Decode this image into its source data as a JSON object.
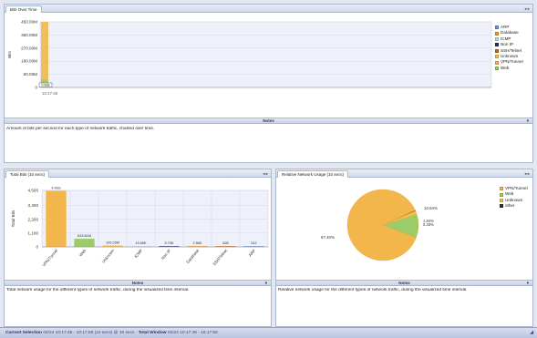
{
  "colors": {
    "ARP": "#7b8ec4",
    "Database": "#e59b2d",
    "ICMP": "#c9d3ea",
    "Non IP": "#27305f",
    "SSH/Telnet": "#c8641e",
    "Unknown": "#f2c14b",
    "VPN/Tunnel": "#f3b64a",
    "Web": "#9ccc6a",
    "other": "#333333"
  },
  "panes": {
    "bits_over_time": {
      "tab": "Bits Over Time",
      "controls": "◂ ▸",
      "notes_label": "Notes",
      "notes_text": "Amount of bits per second for each type of network traffic, charted over time.",
      "legend": [
        "ARP",
        "Database",
        "ICMP",
        "Non IP",
        "SSH/Telnet",
        "Unknown",
        "VPN/Tunnel",
        "Web"
      ]
    },
    "total_bits": {
      "tab": "Total Bits (10 secs)",
      "controls": "◂ ▸",
      "notes_label": "Notes",
      "notes_text": "Total network usage for the different types of network traffic, during the visualized time interval."
    },
    "relative_usage": {
      "tab": "Relative Network Usage (10 secs)",
      "controls": "◂ ▸",
      "notes_label": "Notes",
      "notes_text": "Relative network usage for the different types of network traffic, during the visualized time interval.",
      "legend": [
        "VPN/Tunnel",
        "Web",
        "Unknown",
        "other"
      ]
    }
  },
  "status": {
    "selection_label": "Current Selection",
    "selection_value": "02/24 10:17:48 - 10:17:58 (10 secs) @ 10 secs",
    "separator": "·",
    "window_label": "Total Window",
    "window_value": "02/24 10:17:48 - 10:17:58",
    "grip": "◢"
  },
  "chart_data": [
    {
      "type": "area",
      "title": "",
      "ylabel": "Bits",
      "yticks": [
        "450.00M",
        "360.00M",
        "270.00M",
        "180.00M",
        "90.00M",
        "0"
      ],
      "ylim": [
        0,
        450
      ],
      "x": [
        "10:17:48"
      ],
      "annotations": [
        "0 Bits"
      ],
      "series": [
        {
          "name": "VPN/Tunnel",
          "values": [
            450
          ]
        },
        {
          "name": "Web",
          "values": [
            55
          ]
        },
        {
          "name": "Unknown",
          "values": [
            5
          ]
        }
      ]
    },
    {
      "type": "bar",
      "title": "",
      "ylabel": "Total Bits",
      "yticks": [
        "4,500",
        "3,300",
        "2,200",
        "1,100",
        "0"
      ],
      "ylim": [
        0,
        4500
      ],
      "categories": [
        "VPN/Tunnel",
        "Web",
        "Unknown",
        "ICMP",
        "Non IP",
        "Database",
        "SSH/Telnet",
        "ARP"
      ],
      "values": [
        4463,
        643.81,
        105.25,
        19.56,
        9.73,
        2.56,
        0.828,
        0.512
      ],
      "labels": [
        "4.46G",
        "643.81M",
        "105.25M",
        "19.56K",
        "9.73K",
        "2.56K",
        "828",
        "512"
      ]
    },
    {
      "type": "pie",
      "title": "",
      "categories": [
        "VPN/Tunnel",
        "Web",
        "Unknown",
        "other"
      ],
      "values": [
        87.4,
        10.64,
        1.64,
        0.32
      ],
      "labels": [
        "87.40%",
        "10.64%",
        "1.84%",
        "0.33%"
      ]
    }
  ]
}
